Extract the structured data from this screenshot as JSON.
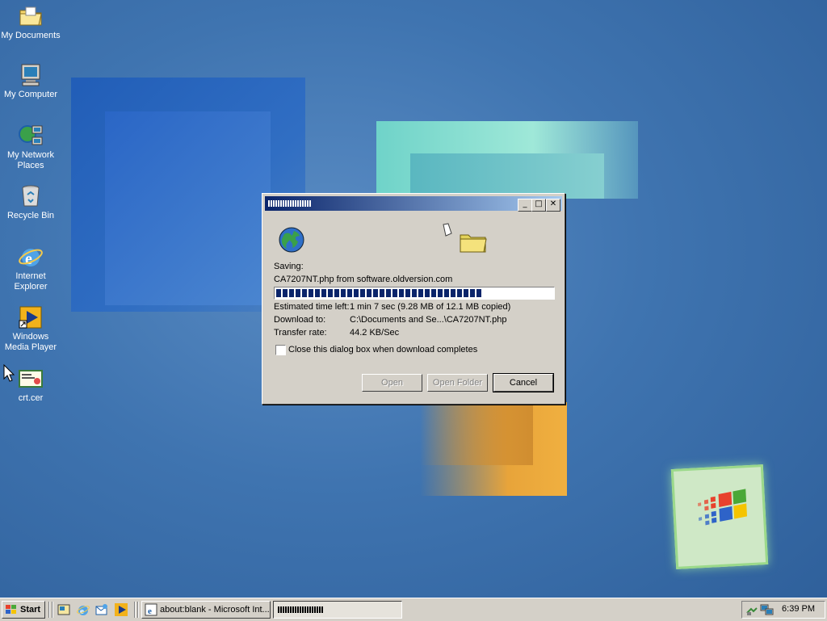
{
  "desktop": {
    "icons": [
      {
        "label": "My Documents"
      },
      {
        "label": "My Computer"
      },
      {
        "label_line1": "My Network",
        "label_line2": "Places"
      },
      {
        "label": "Recycle Bin"
      },
      {
        "label_line1": "Internet",
        "label_line2": "Explorer"
      },
      {
        "label_line1": "Windows",
        "label_line2": "Media Player"
      },
      {
        "label": "crt.cer"
      }
    ]
  },
  "dialog": {
    "saving_label": "Saving:",
    "file_line": "CA7207NT.php from software.oldversion.com",
    "progress_fraction": 0.77,
    "estimated_label": "Estimated time left:",
    "estimated_value": "1 min 7 sec (9.28 MB of 12.1 MB copied)",
    "download_to_label": "Download to:",
    "download_to_value": "C:\\Documents and Se...\\CA7207NT.php",
    "transfer_rate_label": "Transfer rate:",
    "transfer_rate_value": "44.2 KB/Sec",
    "close_checkbox_label": "Close this dialog box when download completes",
    "close_checked": false,
    "buttons": {
      "open": "Open",
      "open_folder": "Open Folder",
      "cancel": "Cancel"
    }
  },
  "taskbar": {
    "start_label": "Start",
    "tasks": [
      {
        "label": "about:blank - Microsoft Int..."
      }
    ],
    "clock": "6:39 PM"
  },
  "colors": {
    "title_start": "#0a246a",
    "title_end": "#a6caf0",
    "progress": "#0a246a",
    "face": "#d4d0c8"
  }
}
